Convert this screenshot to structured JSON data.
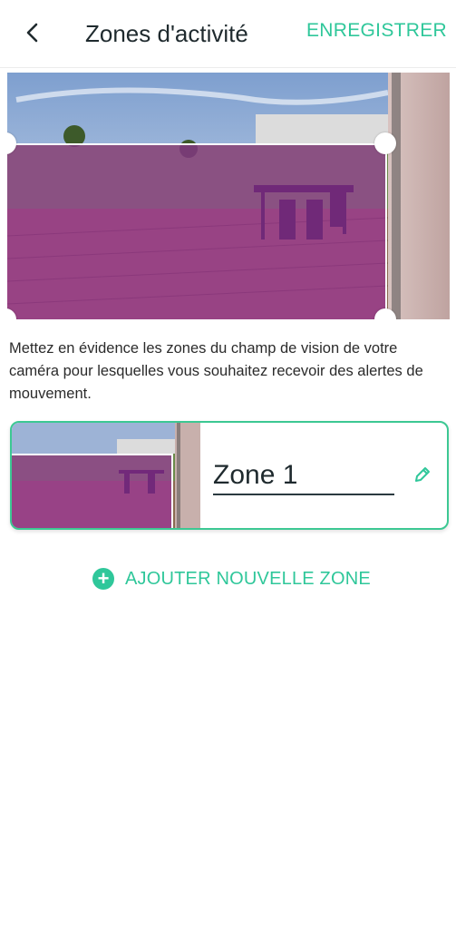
{
  "header": {
    "title": "Zones d'activité",
    "save_label": "ENREGISTRER"
  },
  "description": "Mettez en évidence les zones du champ de vision de votre caméra pour lesquelles vous souhaitez recevoir des alertes de mouvement.",
  "zones": [
    {
      "name": "Zone 1"
    }
  ],
  "add_zone_label": "AJOUTER NOUVELLE ZONE",
  "icons": {
    "back": "chevron-left-icon",
    "edit": "pencil-icon",
    "add": "plus-circle-icon"
  },
  "colors": {
    "accent": "#2fc79a",
    "zone_overlay": "#a228aa"
  }
}
